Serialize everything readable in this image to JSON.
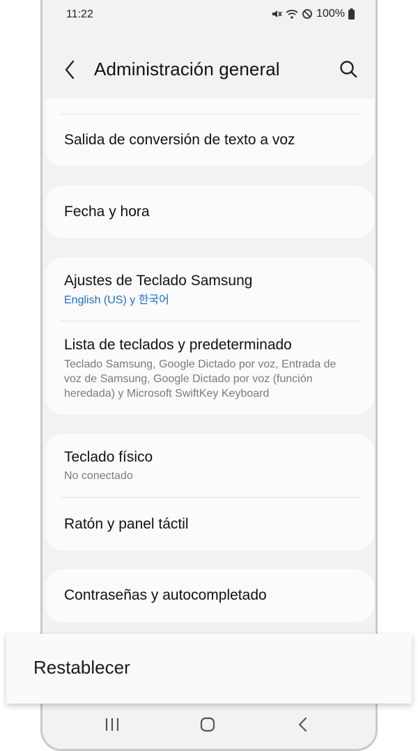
{
  "status_bar": {
    "time": "11:22",
    "battery": "100%"
  },
  "header": {
    "title": "Administración general"
  },
  "list": {
    "tts_output": "Salida de conversión de texto a voz",
    "date_time": "Fecha y hora",
    "samsung_keyboard": {
      "title": "Ajustes de Teclado Samsung",
      "subtitle": "English (US) y 한국어"
    },
    "keyboard_list": {
      "title": "Lista de teclados y predeterminado",
      "subtitle": "Teclado Samsung, Google Dictado por voz, Entrada de voz de Samsung, Google Dictado por voz (función heredada) y Microsoft SwiftKey Keyboard"
    },
    "physical_keyboard": {
      "title": "Teclado físico",
      "subtitle": "No conectado"
    },
    "mouse_trackpad": "Ratón y panel táctil",
    "passwords_autofill": "Contraseñas y autocompletado"
  },
  "highlight": {
    "label": "Restablecer"
  },
  "colors": {
    "accent": "#1b6fc9",
    "background": "#f2f2f2",
    "card": "#fbfbfb"
  },
  "icons": [
    "back-arrow-icon",
    "search-icon",
    "mute-icon",
    "wifi-icon",
    "do-not-disturb-icon",
    "battery-icon",
    "recent-apps-icon",
    "home-icon",
    "back-nav-icon"
  ]
}
